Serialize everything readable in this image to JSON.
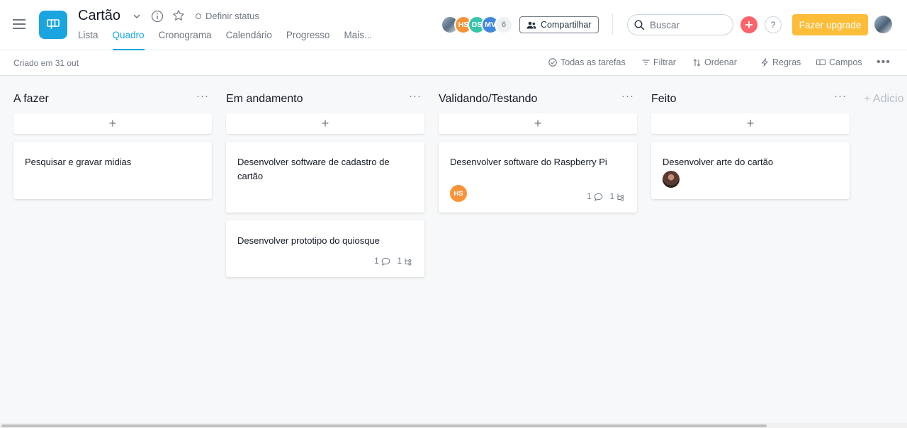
{
  "project": {
    "title": "Cartão",
    "status_label": "Definir status",
    "icon": "board-icon",
    "icon_color": "#1aa5e0"
  },
  "tabs": [
    {
      "label": "Lista",
      "active": false
    },
    {
      "label": "Quadro",
      "active": true
    },
    {
      "label": "Cronograma",
      "active": false
    },
    {
      "label": "Calendário",
      "active": false
    },
    {
      "label": "Progresso",
      "active": false
    },
    {
      "label": "Mais...",
      "active": false
    }
  ],
  "members": {
    "avatars": [
      {
        "initials": "",
        "color": "photo"
      },
      {
        "initials": "HS",
        "color": "#f99338"
      },
      {
        "initials": "DS",
        "color": "#37c5ab"
      },
      {
        "initials": "MV",
        "color": "#4186e0"
      }
    ],
    "count": "6"
  },
  "header": {
    "share_label": "Compartilhar",
    "search_placeholder": "Buscar",
    "upgrade_label": "Fazer upgrade",
    "help_label": "?",
    "accent_upgrade": "#fcbd39",
    "accent_plus": "#fc636b"
  },
  "toolbar": {
    "created": "Criado em 31 out",
    "all_tasks": "Todas as tarefas",
    "filter": "Filtrar",
    "sort": "Ordenar",
    "rules": "Regras",
    "fields": "Campos"
  },
  "board": {
    "add_column_label": "+ Adicio",
    "columns": [
      {
        "title": "A fazer",
        "cards": [
          {
            "title": "Pesquisar e gravar midias",
            "assignee": null,
            "comments": null,
            "subtasks": null
          }
        ]
      },
      {
        "title": "Em andamento",
        "cards": [
          {
            "title": "Desenvolver software de cadastro de cartão",
            "assignee": null,
            "comments": null,
            "subtasks": null
          },
          {
            "title": "Desenvolver prototipo do quiosque",
            "assignee": null,
            "comments": "1",
            "subtasks": "1"
          }
        ]
      },
      {
        "title": "Validando/Testando",
        "cards": [
          {
            "title": "Desenvolver software do Raspberry Pi",
            "assignee": {
              "initials": "HS",
              "color": "#f99338"
            },
            "comments": "1",
            "subtasks": "1"
          }
        ]
      },
      {
        "title": "Feito",
        "cards": [
          {
            "title": "Desenvolver arte do cartão",
            "assignee": {
              "initials": "",
              "color": "photo"
            },
            "comments": null,
            "subtasks": null
          }
        ]
      }
    ]
  }
}
